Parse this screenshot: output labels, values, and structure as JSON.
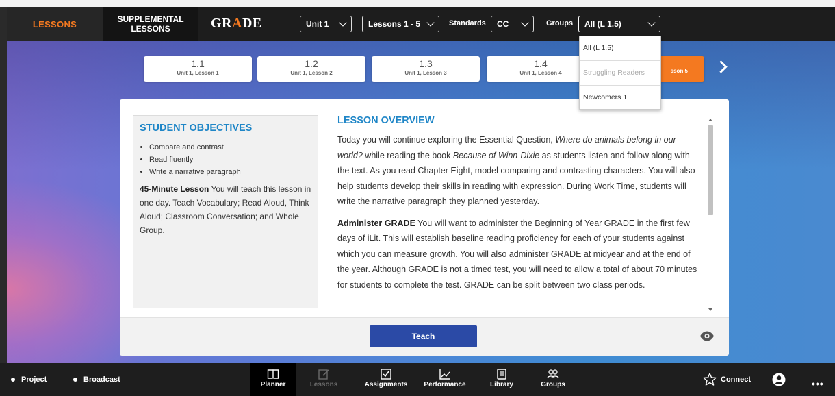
{
  "topbar": {
    "lessons_tab": "LESSONS",
    "supplemental_line1": "SUPPLEMENTAL",
    "supplemental_line2": "LESSONS",
    "grade_logo_pre": "GR",
    "grade_logo_a": "A",
    "grade_logo_post": "DE",
    "unit_select": "Unit 1",
    "lessons_select": "Lessons 1 - 5",
    "standards_label": "Standards",
    "standards_select": "CC",
    "groups_label": "Groups",
    "groups_select": "All (L 1.5)"
  },
  "groups_dropdown": {
    "options": [
      "All (L 1.5)",
      "Struggling Readers",
      "Newcomers 1"
    ]
  },
  "lesson_tabs": [
    {
      "num": "1.1",
      "sub": "Unit 1, Lesson 1"
    },
    {
      "num": "1.2",
      "sub": "Unit 1, Lesson 2"
    },
    {
      "num": "1.3",
      "sub": "Unit 1, Lesson 3"
    },
    {
      "num": "1.4",
      "sub": "Unit 1, Lesson 4"
    },
    {
      "num": "",
      "sub": "sson 5"
    }
  ],
  "objectives": {
    "title": "STUDENT OBJECTIVES",
    "items": [
      "Compare and contrast",
      "Read fluently",
      "Write a narrative paragraph"
    ],
    "lesson_bold": "45-Minute Lesson",
    "lesson_text": " You will teach this lesson in one day. Teach Vocabulary; Read Aloud, Think Aloud; Classroom Conversation; and Whole Group."
  },
  "overview": {
    "title": "LESSON OVERVIEW",
    "p1_a": "Today you will continue exploring the Essential Question, ",
    "p1_i1": "Where do animals belong in our world?",
    "p1_b": " while reading the book ",
    "p1_i2": "Because of Winn-Dixie",
    "p1_c": " as students listen and follow along with the text. As you read Chapter Eight, model comparing and contrasting characters. You will also help students develop their skills in reading with expression. During Work Time, students will write the narrative paragraph they planned yesterday.",
    "p2_bold": "Administer GRADE",
    "p2_text": " You will want to administer the Beginning of Year GRADE in the first few days of iLit. This will establish baseline reading proficiency for each of your students against which you can measure growth. You will also administer GRADE at midyear and at the end of the year. Although GRADE is not a timed test, you will need to allow a total of about 70 minutes for students to complete the test. GRADE can be split between two class periods."
  },
  "card_footer": {
    "teach_button": "Teach"
  },
  "bottombar": {
    "project": "Project",
    "broadcast": "Broadcast",
    "nav": [
      "Planner",
      "Lessons",
      "Assignments",
      "Performance",
      "Library",
      "Groups"
    ],
    "connect": "Connect",
    "more": "•••"
  },
  "colors": {
    "accent_orange": "#f47920",
    "teach_blue": "#2b4aa6",
    "heading_blue": "#1f86c7"
  }
}
